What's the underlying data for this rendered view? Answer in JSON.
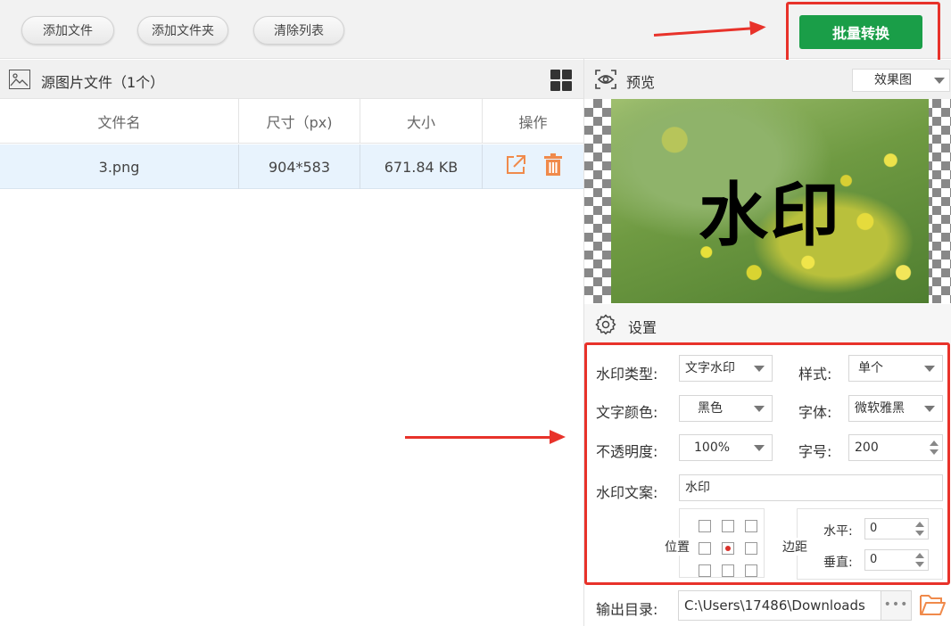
{
  "toolbar": {
    "add_file": "添加文件",
    "add_folder": "添加文件夹",
    "clear_list": "清除列表",
    "convert": "批量转换"
  },
  "file_panel": {
    "title": "源图片文件（1个）",
    "columns": [
      "文件名",
      "尺寸（px)",
      "大小",
      "操作"
    ],
    "rows": [
      {
        "name": "3.png",
        "dimensions": "904*583",
        "size": "671.84 KB"
      }
    ]
  },
  "preview": {
    "label": "预览",
    "mode": "效果图",
    "watermark_text": "水印"
  },
  "settings": {
    "label": "设置",
    "watermark_type_label": "水印类型:",
    "watermark_type": "文字水印",
    "style_label": "样式:",
    "style": "单个",
    "text_color_label": "文字颜色:",
    "text_color": "黑色",
    "font_label": "字体:",
    "font": "微软雅黑",
    "opacity_label": "不透明度:",
    "opacity": "100%",
    "font_size_label": "字号:",
    "font_size": "200",
    "text_label": "水印文案:",
    "text": "水印",
    "position_label": "位置",
    "position_selected": "center",
    "margin_label": "边距",
    "horizontal_label": "水平:",
    "horizontal": "0",
    "vertical_label": "垂直:",
    "vertical": "0"
  },
  "output": {
    "label": "输出目录:",
    "path": "C:\\Users\\17486\\Downloads",
    "more": "•••"
  },
  "colors": {
    "accent_green": "#1a9e48",
    "highlight_red": "#e8322a",
    "action_orange": "#f08a4b",
    "row_selected": "#e8f3fd"
  }
}
